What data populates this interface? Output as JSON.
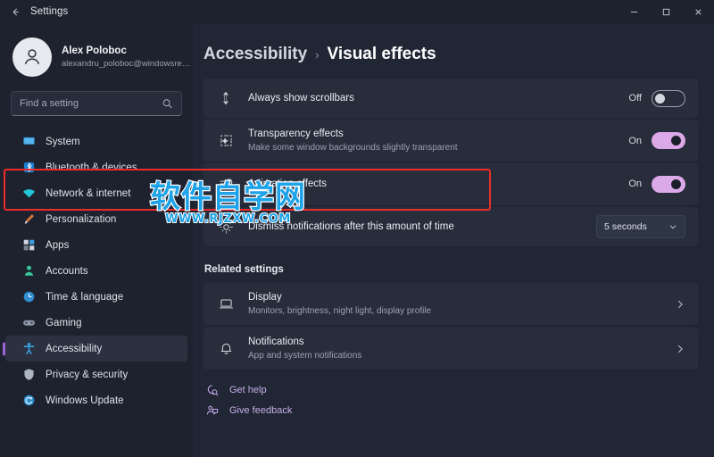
{
  "titlebar": {
    "back_icon": "arrow-left-icon",
    "title": "Settings",
    "minimize_label": "—",
    "maximize_label": "□",
    "close_label": "✕"
  },
  "account": {
    "name": "Alex Poloboc",
    "email": "alexandru_poloboc@windowsreport...",
    "avatar_icon": "person-icon"
  },
  "search": {
    "placeholder": "Find a setting",
    "value": "",
    "icon": "search-icon"
  },
  "sidebar": {
    "items": [
      {
        "label": "System",
        "icon": "display-icon",
        "active": false
      },
      {
        "label": "Bluetooth & devices",
        "icon": "bluetooth-icon",
        "active": false
      },
      {
        "label": "Network & internet",
        "icon": "wifi-icon",
        "active": false
      },
      {
        "label": "Personalization",
        "icon": "paintbrush-icon",
        "active": false
      },
      {
        "label": "Apps",
        "icon": "apps-icon",
        "active": false
      },
      {
        "label": "Accounts",
        "icon": "account-icon",
        "active": false
      },
      {
        "label": "Time & language",
        "icon": "clock-icon",
        "active": false
      },
      {
        "label": "Gaming",
        "icon": "gamepad-icon",
        "active": false
      },
      {
        "label": "Accessibility",
        "icon": "accessibility-icon",
        "active": true
      },
      {
        "label": "Privacy & security",
        "icon": "shield-icon",
        "active": false
      },
      {
        "label": "Windows Update",
        "icon": "update-icon",
        "active": false
      }
    ]
  },
  "breadcrumb": {
    "root": "Accessibility",
    "separator": "›",
    "leaf": "Visual effects"
  },
  "settings": [
    {
      "title": "Always show scrollbars",
      "subtitle": "",
      "icon": "scrollbar-icon",
      "control": "toggle",
      "state_label": "Off",
      "state": "off"
    },
    {
      "title": "Transparency effects",
      "subtitle": "Make some window backgrounds slightly transparent",
      "icon": "transparency-icon",
      "control": "toggle",
      "state_label": "On",
      "state": "on"
    },
    {
      "title": "Animation effects",
      "subtitle": "",
      "icon": "animation-icon",
      "control": "toggle",
      "state_label": "On",
      "state": "on",
      "highlighted": true
    },
    {
      "title": "Dismiss notifications after this amount of time",
      "subtitle": "",
      "icon": "brightness-icon",
      "control": "dropdown",
      "value": "5 seconds",
      "chevron": "chevron-down-icon"
    }
  ],
  "related": {
    "heading": "Related settings",
    "items": [
      {
        "title": "Display",
        "subtitle": "Monitors, brightness, night light, display profile",
        "icon": "monitor-icon",
        "chevron": "chevron-right-icon"
      },
      {
        "title": "Notifications",
        "subtitle": "App and system notifications",
        "icon": "bell-icon",
        "chevron": "chevron-right-icon"
      }
    ]
  },
  "links": [
    {
      "label": "Get help",
      "icon": "help-icon"
    },
    {
      "label": "Give feedback",
      "icon": "feedback-icon"
    }
  ],
  "watermark": {
    "text_cn": "软件自学网",
    "text_url": "WWW.RJZXW.COM"
  },
  "colors": {
    "accent": "#9a63d6",
    "toggle_on": "#dba8e8",
    "highlight_border": "#ee2b2b",
    "link": "#c7aeea",
    "window_bg": "#202634",
    "sidebar_bg": "#1d222e",
    "card_bg": "#272d3b"
  }
}
